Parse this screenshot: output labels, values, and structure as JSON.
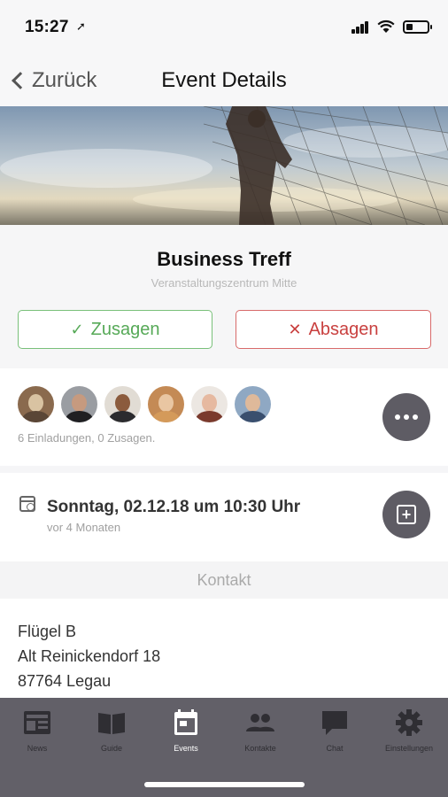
{
  "status": {
    "time": "15:27",
    "location_glyph": "➚"
  },
  "nav": {
    "back_label": "Zurück",
    "title": "Event Details"
  },
  "event": {
    "title": "Business Treff",
    "venue": "Veranstaltungszentrum Mitte",
    "accept_label": "Zusagen",
    "decline_label": "Absagen"
  },
  "participants": {
    "summary": "6 Einladungen, 0 Zusagen.",
    "avatars": [
      "avatar-1",
      "avatar-2",
      "avatar-3",
      "avatar-4",
      "avatar-5",
      "avatar-6"
    ]
  },
  "date": {
    "main": "Sonntag, 02.12.18 um 10:30 Uhr",
    "relative": "vor 4 Monaten"
  },
  "contact": {
    "section_title": "Kontakt",
    "lines": [
      "Flügel B",
      "Alt Reinickendorf 18",
      "87764 Legau"
    ]
  },
  "tabs": [
    {
      "label": "News",
      "icon": "news-icon"
    },
    {
      "label": "Guide",
      "icon": "book-icon"
    },
    {
      "label": "Events",
      "icon": "calendar-icon"
    },
    {
      "label": "Kontakte",
      "icon": "people-icon"
    },
    {
      "label": "Chat",
      "icon": "chat-icon"
    },
    {
      "label": "Einstellungen",
      "icon": "gear-icon"
    }
  ],
  "active_tab": "Events",
  "colors": {
    "accept": "#56a957",
    "decline": "#c9403f",
    "tabbar": "#626068",
    "round_button": "#5e5c64"
  }
}
